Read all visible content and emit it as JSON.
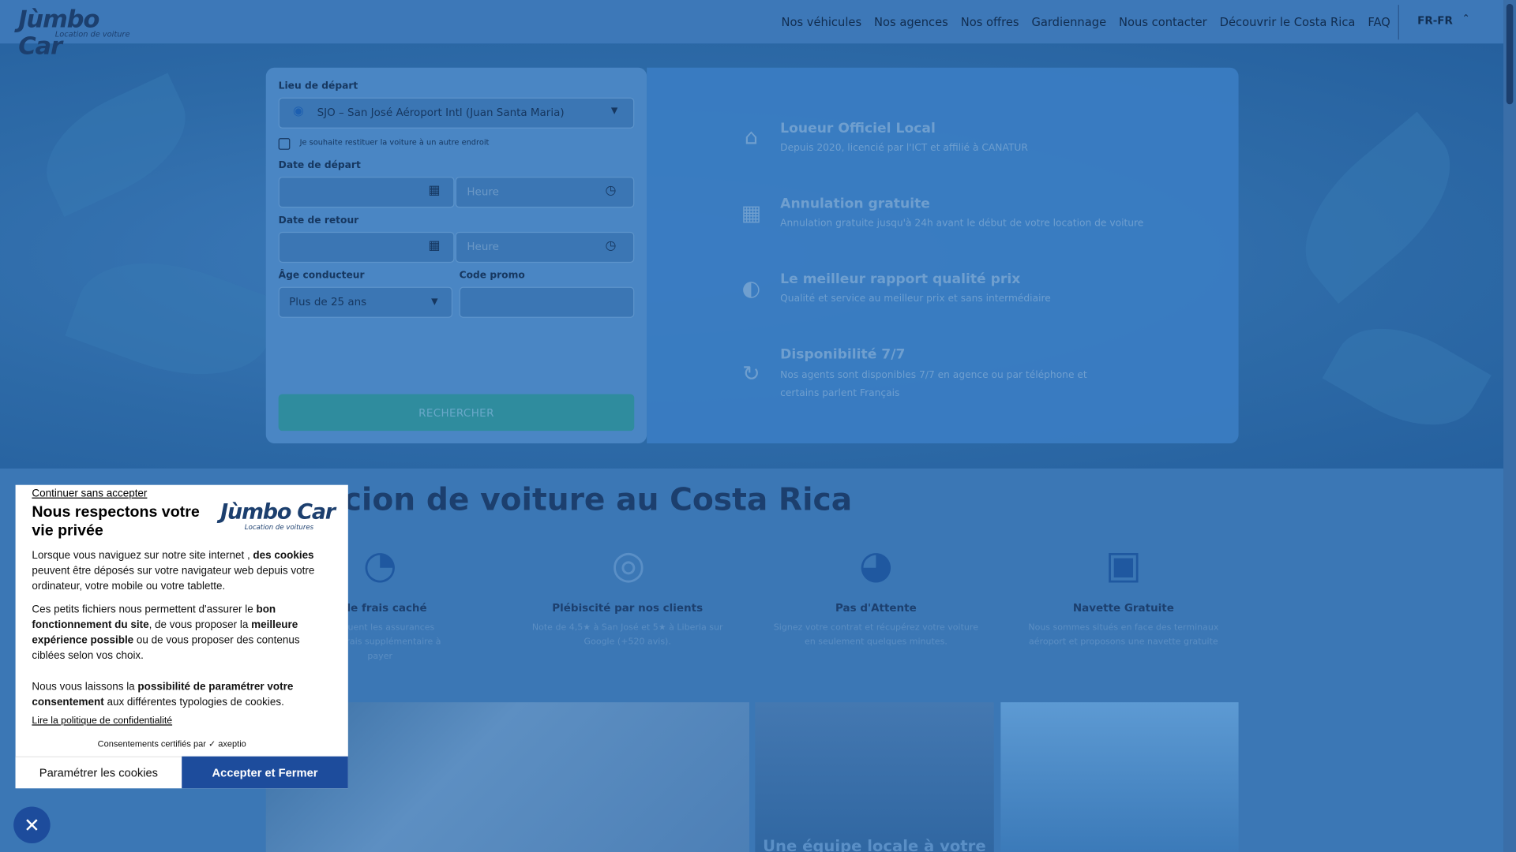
{
  "header": {
    "logo_text": "Jùmbo Car",
    "logo_tagline": "Location de voiture",
    "nav": [
      "Nos véhicules",
      "Nos agences",
      "Nos offres",
      "Gardiennage",
      "Nous contacter",
      "Découvrir le Costa Rica",
      "FAQ"
    ],
    "language": "FR-FR"
  },
  "form": {
    "departure_label": "Lieu de départ",
    "departure_value": "SJO – San José Aéroport Intl (Juan Santa Maria)",
    "return_other_label": "Je souhaite restituer la voiture à un autre endroit",
    "start_date_label": "Date de départ",
    "return_date_label": "Date de retour",
    "time_placeholder": "Heure",
    "age_label": "Âge conducteur",
    "age_value": "Plus de 25 ans",
    "promo_label": "Code promo",
    "search_button": "RECHERCHER"
  },
  "benefits": [
    {
      "title": "Loueur Officiel Local",
      "desc": "Depuis 2020, licencié par l'ICT et affilié à CANATUR",
      "icon": "map-pin-icon"
    },
    {
      "title": "Annulation gratuite",
      "desc": "Annulation gratuite jusqu'à 24h avant le début de votre location de voiture",
      "icon": "calendar-cancel-icon"
    },
    {
      "title": "Le meilleur rapport qualité prix",
      "desc": "Qualité et service au meilleur prix et sans intermédiaire",
      "icon": "piggy-bank-icon"
    },
    {
      "title": "Disponibilité 7/7",
      "desc": "Nos agents sont disponibles 7/7 en agence ou par téléphone et certains parlent Français",
      "icon": "clock-refresh-icon"
    }
  ],
  "section2": {
    "title": "cion de voiture au Costa Rica",
    "features": [
      {
        "title": "s de frais caché",
        "desc": "s incluent les assurances\nucun frais supplémentaire à\npayer",
        "icon": "hand-money-icon"
      },
      {
        "title": "Plébiscité par nos clients",
        "desc": "Note de 4,5★ à San José et 5★ à Liberia sur\nGoogle (+520 avis).",
        "icon": "award-badge-icon"
      },
      {
        "title": "Pas d'Attente",
        "desc": "Signez votre contrat et récupérez votre voiture\nen seulement quelques minutes.",
        "icon": "speedometer-icon"
      },
      {
        "title": "Navette Gratuite",
        "desc": "Nous sommes situés en face des terminaux\naéroport et proposons une navette gratuite",
        "icon": "bus-icon"
      }
    ],
    "photo2_caption": "Une équipe locale à votre"
  },
  "cookie": {
    "skip": "Continuer sans accepter",
    "title": "Nous respectons votre vie privée",
    "logo_text": "Jùmbo Car",
    "logo_tagline": "Location de voitures",
    "p1_a": "Lorsque vous naviguez sur notre site internet , ",
    "p1_b": "des cookies",
    "p1_c": " peuvent être déposés sur votre navigateur web depuis votre ordinateur, votre mobile ou votre tablette.",
    "p2_a": "Ces petits fichiers nous permettent d'assurer le ",
    "p2_b": "bon fonctionnement du site",
    "p2_c": ", de vous proposer la ",
    "p2_d": "meilleure expérience possible",
    "p2_e": " ou de vous proposer des contenus ciblées selon vos choix.",
    "p3_a": "Nous vous laissons la ",
    "p3_b": "possibilité de paramétrer votre consentement",
    "p3_c": " aux différentes typologies de cookies.",
    "policy_link": "Lire la politique de confidentialité",
    "certified": "Consentements certifiés par ✓ axeptio",
    "settings_button": "Paramétrer les cookies",
    "accept_button": "Accepter et Fermer"
  },
  "colors": {
    "overlay": "#2f6fae",
    "accent": "#1d4c9c",
    "brand": "#1c3f6e"
  }
}
